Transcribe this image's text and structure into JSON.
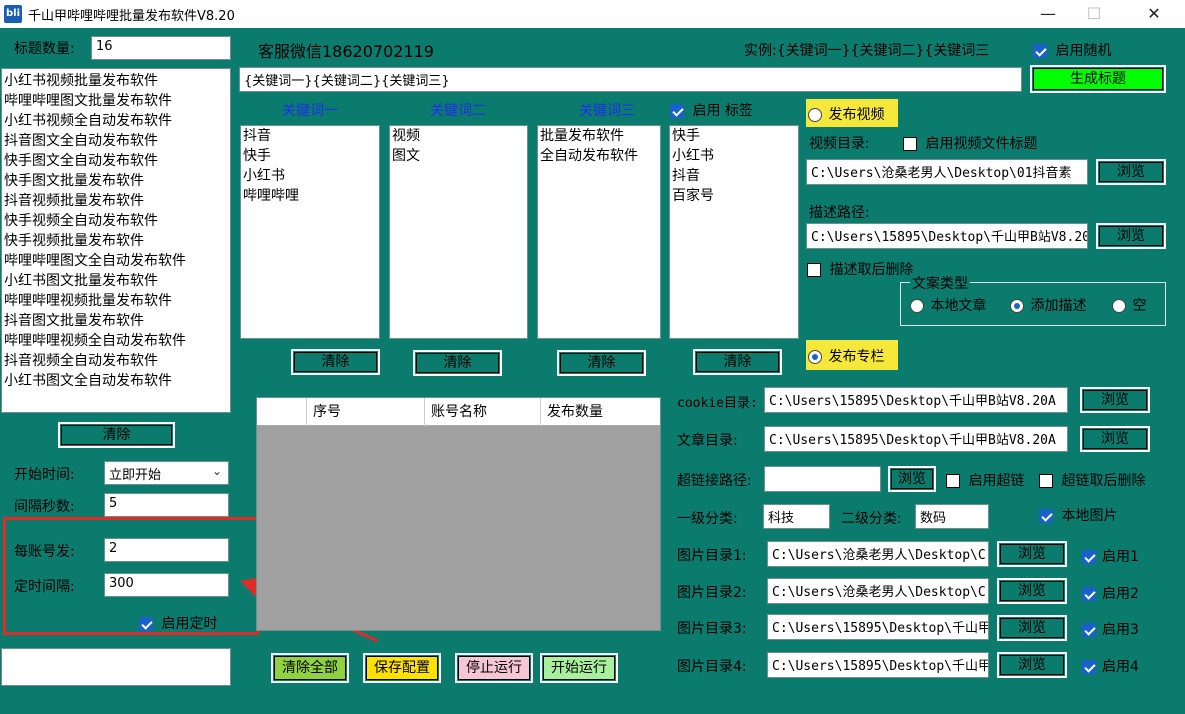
{
  "window": {
    "icon_text": "bli",
    "title": "千山甲哔哩哔哩批量发布软件V8.20",
    "min": "—",
    "max": "☐",
    "close": "✕"
  },
  "left": {
    "title_count_label": "标题数量:",
    "title_count_value": "16",
    "titles": [
      "小红书视频批量发布软件",
      "哔哩哔哩图文批量发布软件",
      "小红书视频全自动发布软件",
      "抖音图文全自动发布软件",
      "快手图文全自动发布软件",
      "快手图文批量发布软件",
      "抖音视频批量发布软件",
      "快手视频全自动发布软件",
      "快手视频批量发布软件",
      "哔哩哔哩图文全自动发布软件",
      "小红书图文批量发布软件",
      "哔哩哔哩视频批量发布软件",
      "抖音图文批量发布软件",
      "哔哩哔哩视频全自动发布软件",
      "抖音视频全自动发布软件",
      "小红书图文全自动发布软件"
    ],
    "clear_label": "清除",
    "start_time_label": "开始时间:",
    "start_time_value": "立即开始",
    "interval_label": "间隔秒数:",
    "interval_value": "5",
    "per_account_label": "每账号发:",
    "per_account_value": "2",
    "timer_interval_label": "定时间隔:",
    "timer_interval_value": "300",
    "enable_timer_label": "启用定时",
    "bottom_input": ""
  },
  "top": {
    "support": "客服微信18620702119",
    "example": "实例:{关键词一}{关键词二}{关键词三",
    "random_label": "启用随机",
    "template": "{关键词一}{关键词二}{关键词三}",
    "generate_label": "生成标题"
  },
  "keywords": {
    "headers": [
      "关键词一",
      "关键词二",
      "关键词三"
    ],
    "tag_label": "启用 标签",
    "col1": [
      "抖音",
      "快手",
      "小红书",
      "哔哩哔哩"
    ],
    "col2": [
      "视频",
      "图文"
    ],
    "col3": [
      "批量发布软件",
      "全自动发布软件"
    ],
    "col4": [
      "快手",
      "小红书",
      "抖音",
      "百家号"
    ],
    "clear_label": "清除"
  },
  "accounts_table": {
    "columns": [
      "",
      "序号",
      "账号名称",
      "发布数量"
    ]
  },
  "actions": {
    "clear_all": "清除全部",
    "save_config": "保存配置",
    "stop": "停止运行",
    "start": "开始运行"
  },
  "video": {
    "publish_label": "发布视频",
    "dir_label": "视频目录:",
    "use_filename_label": "启用视频文件标题",
    "dir_value": "C:\\Users\\沧桑老男人\\Desktop\\01抖音素",
    "browse": "浏览",
    "desc_label": "描述路径:",
    "desc_value": "C:\\Users\\15895\\Desktop\\千山甲B站V8.20",
    "desc_delete_label": "描述取后删除",
    "copy_type_label": "文案类型",
    "copy_types": [
      "本地文章",
      "添加描述",
      "空"
    ]
  },
  "column": {
    "publish_label": "发布专栏",
    "cookie_label": "cookie目录:",
    "cookie_value": "C:\\Users\\15895\\Desktop\\千山甲B站V8.20A",
    "article_label": "文章目录:",
    "article_value": "C:\\Users\\15895\\Desktop\\千山甲B站V8.20A",
    "link_label": "超链接路径:",
    "link_value": "",
    "enable_link_label": "启用超链",
    "link_delete_label": "超链取后删除",
    "cat1_label": "一级分类:",
    "cat1_value": "科技",
    "cat2_label": "二级分类:",
    "cat2_value": "数码",
    "local_image_label": "本地图片",
    "images": [
      {
        "label": "图片目录1:",
        "value": "C:\\Users\\沧桑老男人\\Desktop\\C",
        "enable": "启用1"
      },
      {
        "label": "图片目录2:",
        "value": "C:\\Users\\沧桑老男人\\Desktop\\C",
        "enable": "启用2"
      },
      {
        "label": "图片目录3:",
        "value": "C:\\Users\\15895\\Desktop\\千山甲",
        "enable": "启用3"
      },
      {
        "label": "图片目录4:",
        "value": "C:\\Users\\15895\\Desktop\\千山甲",
        "enable": "启用4"
      }
    ],
    "browse": "浏览"
  },
  "colors": {
    "background": "#0b7b6e",
    "generate_button": "#00ff00",
    "publish_highlight": "#f5e83a",
    "annotation_red": "#e02b2b",
    "keyword_header": "#1e2cf2"
  }
}
